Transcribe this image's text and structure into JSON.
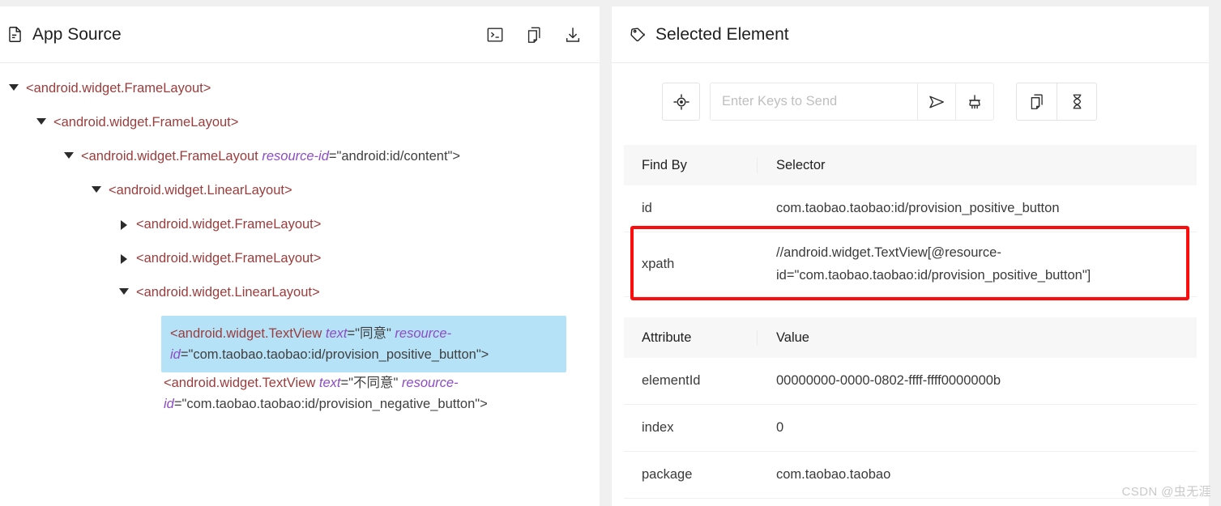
{
  "left": {
    "title": "App Source",
    "title_icon": "file-text-icon",
    "actions": [
      {
        "name": "terminal-icon",
        "label": "Terminal"
      },
      {
        "name": "copy-icon",
        "label": "Copy"
      },
      {
        "name": "download-icon",
        "label": "Download"
      }
    ],
    "tree": [
      {
        "depth": 0,
        "state": "open",
        "text": "<android.widget.FrameLayout>"
      },
      {
        "depth": 1,
        "state": "open",
        "text": "<android.widget.FrameLayout>"
      },
      {
        "depth": 2,
        "state": "open",
        "text": "<android.widget.FrameLayout ",
        "attr": "resource-id",
        "value": "=\"android:id/content\">"
      },
      {
        "depth": 3,
        "state": "open",
        "text": "<android.widget.LinearLayout>"
      },
      {
        "depth": 4,
        "state": "closed",
        "text": "<android.widget.FrameLayout>"
      },
      {
        "depth": 4,
        "state": "closed",
        "text": "<android.widget.FrameLayout>"
      },
      {
        "depth": 4,
        "state": "open",
        "text": "<android.widget.LinearLayout>"
      },
      {
        "depth": 5,
        "state": "none",
        "selected": true,
        "tag": "<android.widget.TextView ",
        "attr1": "text",
        "val1": "=\"同意\" ",
        "attr2": "resource-id",
        "val2": "=\"com.taobao.taobao:id/provision_positive_button\">"
      },
      {
        "depth": 5,
        "state": "none",
        "selected": false,
        "tag": "<android.widget.TextView ",
        "attr1": "text",
        "val1": "=\"不同意\" ",
        "attr2": "resource-id",
        "val2": "=\"com.taobao.taobao:id/provision_negative_button\">"
      }
    ]
  },
  "right": {
    "title": "Selected Element",
    "title_icon": "tag-icon",
    "toolbar": {
      "tap_button": "crosshair-target-icon",
      "keys_placeholder": "Enter Keys to Send",
      "keys_value": "",
      "send_button": "send-arrow-icon",
      "clear_button": "broom-icon",
      "copy_button": "copy-icon",
      "wait_button": "hourglass-icon"
    },
    "selector_table": {
      "headers": [
        "Find By",
        "Selector"
      ],
      "rows": [
        {
          "find_by": "id",
          "selector": "com.taobao.taobao:id/provision_positive_button",
          "highlighted": false
        },
        {
          "find_by": "xpath",
          "selector": "//android.widget.TextView[@resource-id=\"com.taobao.taobao:id/provision_positive_button\"]",
          "highlighted": true
        }
      ]
    },
    "attribute_table": {
      "headers": [
        "Attribute",
        "Value"
      ],
      "rows": [
        {
          "attribute": "elementId",
          "value": "00000000-0000-0802-ffff-ffff0000000b"
        },
        {
          "attribute": "index",
          "value": "0"
        },
        {
          "attribute": "package",
          "value": "com.taobao.taobao"
        }
      ]
    }
  },
  "watermark": "CSDN @虫无涯",
  "colors": {
    "highlight_blue": "#b6e2f8",
    "annotation_red": "#fb0d0d",
    "tag_maroon": "#9b3c3c",
    "attr_purple": "#8d4cc4",
    "header_gray": "#f7f7f7"
  }
}
